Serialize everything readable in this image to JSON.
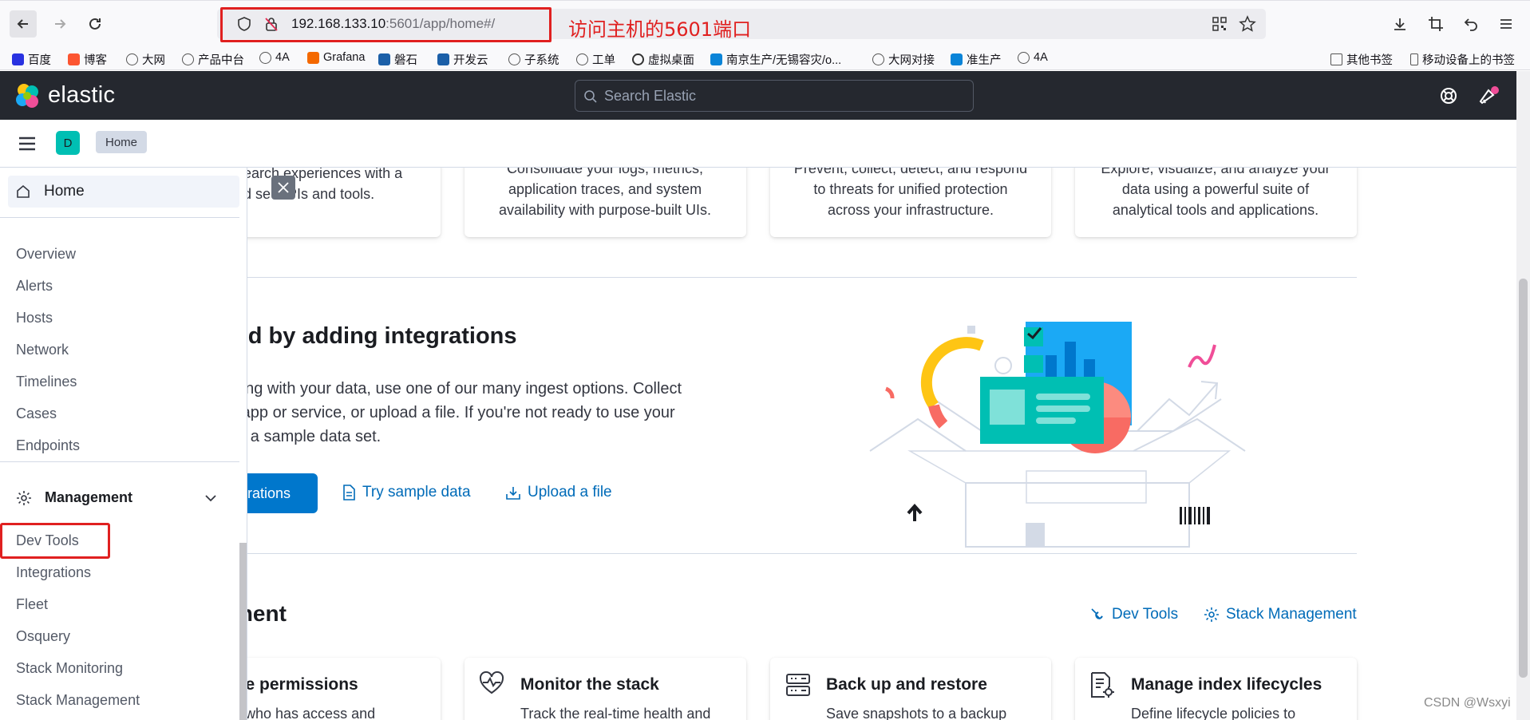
{
  "browser": {
    "url_host": "192.168.133.10",
    "url_path": ":5601/app/home#/",
    "annotation": "访问主机的5601端口"
  },
  "bookmarks": [
    {
      "label": "百度",
      "icon": "baidu-icon",
      "color": "#2932e1"
    },
    {
      "label": "博客",
      "icon": "csdn-icon",
      "color": "#fc5531"
    },
    {
      "label": "大网",
      "icon": "globe-icon",
      "color": "#555"
    },
    {
      "label": "产品中台",
      "icon": "globe-icon",
      "color": "#555"
    },
    {
      "label": "4A",
      "icon": "globe-icon",
      "color": "#555"
    },
    {
      "label": "Grafana",
      "icon": "grafana-icon",
      "color": "#f46800"
    },
    {
      "label": "磐石",
      "icon": "panshi-icon",
      "color": "#1b5fa8"
    },
    {
      "label": "开发云",
      "icon": "devcloud-icon",
      "color": "#1b5fa8"
    },
    {
      "label": "子系统",
      "icon": "globe-icon",
      "color": "#555"
    },
    {
      "label": "工单",
      "icon": "globe-icon",
      "color": "#555"
    },
    {
      "label": "虚拟桌面",
      "icon": "vdesk-icon",
      "color": "#333"
    },
    {
      "label": "南京生产/无锡容灾/o...",
      "icon": "edge-icon",
      "color": "#0a84d8"
    },
    {
      "label": "大网对接",
      "icon": "globe-icon",
      "color": "#555"
    },
    {
      "label": "准生产",
      "icon": "edge-icon",
      "color": "#0a84d8"
    },
    {
      "label": "4A",
      "icon": "globe-icon",
      "color": "#555"
    }
  ],
  "bookmarks_right": {
    "other": "其他书签",
    "mobile": "移动设备上的书签"
  },
  "header": {
    "logo": "elastic",
    "search_placeholder": "Search Elastic"
  },
  "subheader": {
    "space_initial": "D",
    "breadcrumb": "Home"
  },
  "sidebar": {
    "home": "Home",
    "security_items": [
      "Overview",
      "Alerts",
      "Hosts",
      "Network",
      "Timelines",
      "Cases",
      "Endpoints"
    ],
    "management_label": "Management",
    "management_items": [
      "Dev Tools",
      "Integrations",
      "Fleet",
      "Osquery",
      "Stack Monitoring",
      "Stack Management"
    ]
  },
  "solutions": [
    {
      "lines": [
        "earch experiences with a",
        "d se  APIs and tools."
      ]
    },
    {
      "lines": [
        "Consolidate your logs, metrics,",
        "application traces, and system",
        "availability with purpose-built UIs."
      ]
    },
    {
      "lines": [
        "Prevent, collect, detect, and respond",
        "to threats for unified protection",
        "across your infrastructure."
      ]
    },
    {
      "lines": [
        "Explore, visualize, and analyze your",
        "data using a powerful suite of",
        "analytical tools and applications."
      ]
    }
  ],
  "integrations": {
    "title": "ted by adding integrations",
    "desc": [
      "rking with your data, use one of our many ingest options. Collect",
      "n app or service, or upload a file. If you're not ready to use your",
      "dd a sample data set."
    ],
    "primary_button": "egrations",
    "sample_button": "Try sample data",
    "upload_button": "Upload a file"
  },
  "management": {
    "title": "ment",
    "dev_tools_link": "Dev Tools",
    "stack_mgmt_link": "Stack Management",
    "cards": [
      {
        "title": "age permissions",
        "desc": "rol who has access and"
      },
      {
        "title": "Monitor the stack",
        "desc": "Track the real-time health and"
      },
      {
        "title": "Back up and restore",
        "desc": "Save snapshots to a backup"
      },
      {
        "title": "Manage index lifecycles",
        "desc": "Define lifecycle policies to"
      }
    ]
  },
  "colors": {
    "accent": "#0077cc",
    "annotation": "#e02020",
    "header_bg": "#25282f",
    "space_avatar": "#00bfb3"
  },
  "watermark": "CSDN @Wsxyi"
}
